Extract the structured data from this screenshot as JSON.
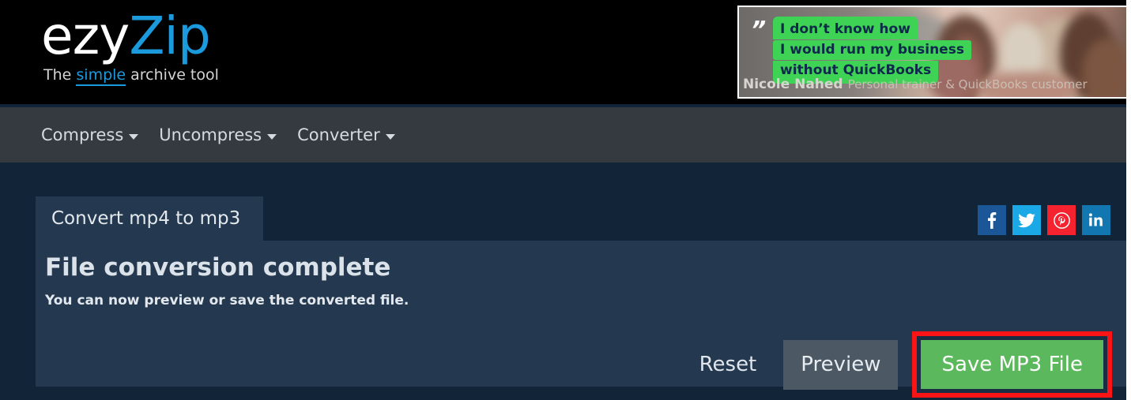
{
  "site": {
    "logo_primary": "ezy",
    "logo_secondary": "Zip",
    "tagline_before": "The ",
    "tagline_highlight": "simple",
    "tagline_after": " archive tool",
    "colors": {
      "accent_blue": "#1b9bdd",
      "nav_bg": "#343a40",
      "page_bg": "#122538",
      "card_bg": "#24394f",
      "success_green": "#5cb85c",
      "highlight_red": "#fb1416"
    }
  },
  "ad": {
    "quote_line1": "I don’t know how",
    "quote_line2": "I would run my business",
    "quote_line3": "without QuickBooks",
    "attribution_name": "Nicole Nahed",
    "attribution_role": "Personal trainer & QuickBooks customer",
    "quote_mark": "”"
  },
  "nav": {
    "items": [
      {
        "label": "Compress"
      },
      {
        "label": "Uncompress"
      },
      {
        "label": "Converter"
      }
    ]
  },
  "card": {
    "tab_label": "Convert mp4 to mp3",
    "heading": "File conversion complete",
    "subtext": "You can now preview or save the converted file.",
    "buttons": {
      "reset": "Reset",
      "preview": "Preview",
      "save": "Save MP3 File"
    }
  },
  "social": {
    "items": [
      {
        "name": "facebook",
        "glyph": "f"
      },
      {
        "name": "twitter",
        "glyph": "t"
      },
      {
        "name": "pinterest",
        "glyph": "p"
      },
      {
        "name": "linkedin",
        "glyph": "in"
      }
    ]
  }
}
